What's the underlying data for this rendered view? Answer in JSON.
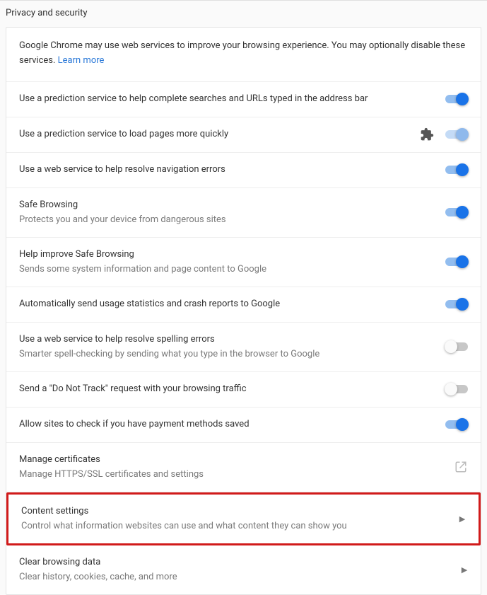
{
  "header": {
    "title": "Privacy and security"
  },
  "intro": {
    "text": "Google Chrome may use web services to improve your browsing experience. You may optionally disable these services. ",
    "link": "Learn more"
  },
  "rows": {
    "r1": {
      "label": "Use a prediction service to help complete searches and URLs typed in the address bar"
    },
    "r2": {
      "label": "Use a prediction service to load pages more quickly"
    },
    "r3": {
      "label": "Use a web service to help resolve navigation errors"
    },
    "r4": {
      "label": "Safe Browsing",
      "sub": "Protects you and your device from dangerous sites"
    },
    "r5": {
      "label": "Help improve Safe Browsing",
      "sub": "Sends some system information and page content to Google"
    },
    "r6": {
      "label": "Automatically send usage statistics and crash reports to Google"
    },
    "r7": {
      "label": "Use a web service to help resolve spelling errors",
      "sub": "Smarter spell-checking by sending what you type in the browser to Google"
    },
    "r8": {
      "label": "Send a \"Do Not Track\" request with your browsing traffic"
    },
    "r9": {
      "label": "Allow sites to check if you have payment methods saved"
    },
    "r10": {
      "label": "Manage certificates",
      "sub": "Manage HTTPS/SSL certificates and settings"
    },
    "r11": {
      "label": "Content settings",
      "sub": "Control what information websites can use and what content they can show you"
    },
    "r12": {
      "label": "Clear browsing data",
      "sub": "Clear history, cookies, cache, and more"
    }
  }
}
